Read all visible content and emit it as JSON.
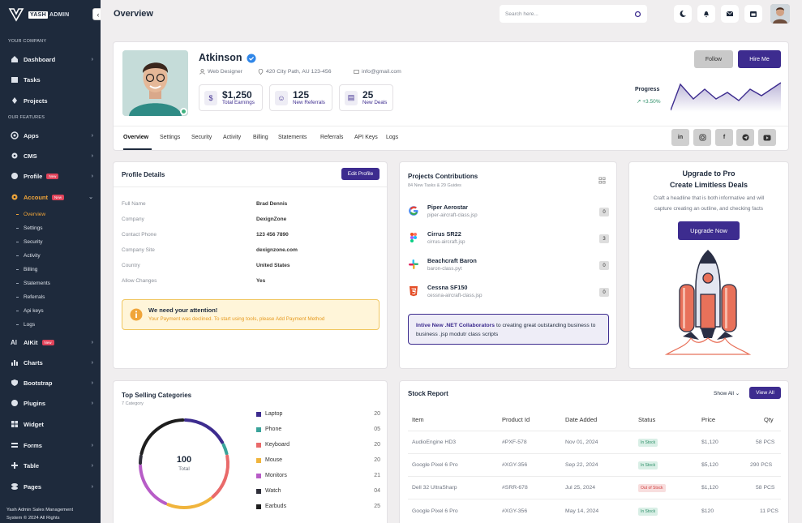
{
  "sidebar": {
    "logo_text": "YASH",
    "logo_text2": "ADMIN",
    "section1": "YOUR COMPANY",
    "section2": "OUR FEATURES",
    "items": [
      {
        "label": "Dashboard",
        "icon": "home-icon"
      },
      {
        "label": "Tasks",
        "icon": "calendar-icon"
      },
      {
        "label": "Projects",
        "icon": "pin-icon"
      },
      {
        "label": "Apps",
        "icon": "target-icon"
      },
      {
        "label": "CMS",
        "icon": "gear-icon"
      },
      {
        "label": "Profile",
        "icon": "user-icon",
        "badge": "New"
      },
      {
        "label": "Account",
        "icon": "gear-icon",
        "badge": "New"
      },
      {
        "label": "AIKit",
        "icon": "ai-icon",
        "badge": "New"
      },
      {
        "label": "Charts",
        "icon": "chart-icon"
      },
      {
        "label": "Bootstrap",
        "icon": "shield-icon"
      },
      {
        "label": "Plugins",
        "icon": "plugin-icon"
      },
      {
        "label": "Widget",
        "icon": "grid-icon"
      },
      {
        "label": "Forms",
        "icon": "form-icon"
      },
      {
        "label": "Table",
        "icon": "table-icon"
      },
      {
        "label": "Pages",
        "icon": "pages-icon"
      }
    ],
    "sub_items": [
      "Overview",
      "Settings",
      "Security",
      "Activity",
      "Billing",
      "Statements",
      "Referrals",
      "Api keys",
      "Logs"
    ],
    "footer1": "Yash Admin Sales Management",
    "footer2": "System © 2024 All Rights"
  },
  "topbar": {
    "title": "Overview",
    "search_placeholder": "Search here..."
  },
  "profile": {
    "name": "Atkinson",
    "role": "Web Designer",
    "address": "420 City Path, AU 123-456",
    "email": "info@gmail.com",
    "stats": [
      {
        "value": "$1,250",
        "label": "Total Earnings"
      },
      {
        "value": "125",
        "label": "New Referrals"
      },
      {
        "value": "25",
        "label": "New Deals"
      }
    ],
    "follow_label": "Follow",
    "hire_label": "Hire Me",
    "progress_label": "Progress",
    "progress_value": "+3.50%",
    "tabs": [
      "Overview",
      "Settings",
      "Security",
      "Activity",
      "Billing",
      "Statements",
      "Referrals",
      "API Keys",
      "Logs"
    ],
    "social": [
      "in",
      "ig",
      "f",
      "tg",
      "yt"
    ]
  },
  "details": {
    "title": "Profile Details",
    "edit_label": "Edit Profile",
    "rows": [
      {
        "label": "Full Name",
        "value": "Brad Dennis"
      },
      {
        "label": "Company",
        "value": "DexignZone"
      },
      {
        "label": "Contact Phone",
        "value": "123 456 7890"
      },
      {
        "label": "Company Site",
        "value": "dexignzone.com"
      },
      {
        "label": "Country",
        "value": "United States"
      },
      {
        "label": "Allow Changes",
        "value": "Yes"
      }
    ],
    "alert_title": "We need your attention!",
    "alert_text": "Your Payment was declined. To start using tools, please Add Payment Method"
  },
  "projects": {
    "title": "Projects Contributions",
    "subtitle": "84 New Tasks & 29 Guides",
    "items": [
      {
        "name": "Piper Aerostar",
        "file": "piper-aircraft-class.jsp",
        "count": "0"
      },
      {
        "name": "Cirrus SR22",
        "file": "cirrus-aircraft.jsp",
        "count": "3"
      },
      {
        "name": "Beachcraft Baron",
        "file": "baron-class.pyt",
        "count": "0"
      },
      {
        "name": "Cessna SF150",
        "file": "cessna-aircraft-class.jsp",
        "count": "0"
      }
    ],
    "invite_bold": "Intive New .NET Collaborators",
    "invite_text": " to creating great outstanding business to business .jsp modutr class scripts"
  },
  "upgrade": {
    "title1": "Upgrade to Pro",
    "title2": "Create Limitless Deals",
    "text1": "Craft a headline that is both informative and will",
    "text2": "capture creating an outline, and checking facts",
    "button": "Upgrade Now"
  },
  "categories": {
    "title": "Top Selling Categories",
    "subtitle": "7 Category",
    "total_value": "100",
    "total_label": "Total",
    "items": [
      {
        "name": "Laptop",
        "value": "20",
        "color": "#3d2c8f"
      },
      {
        "name": "Phone",
        "value": "05",
        "color": "#3aa39a"
      },
      {
        "name": "Keyboard",
        "value": "20",
        "color": "#e96a6a"
      },
      {
        "name": "Mouse",
        "value": "20",
        "color": "#f0b43c"
      },
      {
        "name": "Monitors",
        "value": "21",
        "color": "#b75cc7"
      },
      {
        "name": "Watch",
        "value": "04",
        "color": "#2f2f3a"
      },
      {
        "name": "Earbuds",
        "value": "25",
        "color": "#1e1e1e"
      }
    ]
  },
  "chart_data": {
    "type": "pie",
    "categories": [
      "Laptop",
      "Phone",
      "Keyboard",
      "Mouse",
      "Monitors",
      "Watch",
      "Earbuds"
    ],
    "values": [
      20,
      5,
      20,
      20,
      21,
      4,
      25
    ]
  },
  "stock": {
    "title": "Stock Report",
    "show_all": "Show All",
    "view_all": "View All",
    "headers": [
      "Item",
      "Product Id",
      "Date Added",
      "Status",
      "Price",
      "Qty"
    ],
    "rows": [
      {
        "item": "AudioEngine HD3",
        "id": "#PXF-578",
        "date": "Nov 01, 2024",
        "status": "In Stock",
        "price": "$1,120",
        "qty": "58 PCS"
      },
      {
        "item": "Google Pixel 6 Pro",
        "id": "#XGY-356",
        "date": "Sep 22, 2024",
        "status": "In Stock",
        "price": "$5,120",
        "qty": "290 PCS"
      },
      {
        "item": "Dell 32 UltraSharp",
        "id": "#SRR-678",
        "date": "Jul 25, 2024",
        "status": "Out of Stock",
        "price": "$1,120",
        "qty": "58 PCS"
      },
      {
        "item": "Google Pixel 6 Pro",
        "id": "#XGY-356",
        "date": "May 14, 2024",
        "status": "In Stock",
        "price": "$120",
        "qty": "11 PCS"
      }
    ]
  },
  "colors": {
    "primary": "#3d2c8f",
    "sidebar": "#1e2a3c",
    "accent": "#f0a53a"
  }
}
